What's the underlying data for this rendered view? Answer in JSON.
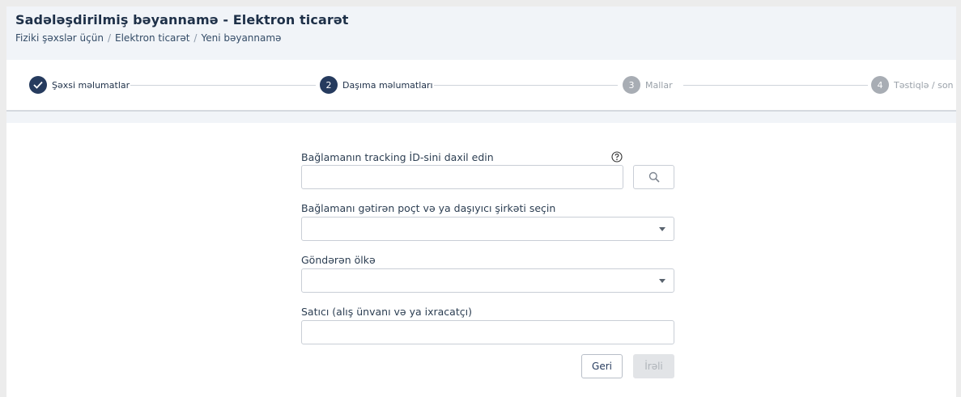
{
  "header": {
    "title": "Sadələşdirilmiş bəyannamə - Elektron ticarət",
    "breadcrumb": [
      "Fiziki şəxslər üçün",
      "Elektron ticarət",
      "Yeni bəyannamə"
    ]
  },
  "steps": [
    {
      "number": "✓",
      "label": "Şəxsi məlumatlar",
      "state": "done"
    },
    {
      "number": "2",
      "label": "Daşıma məlumatları",
      "state": "active"
    },
    {
      "number": "3",
      "label": "Mallar",
      "state": "todo"
    },
    {
      "number": "4",
      "label": "Təstiqlə / son",
      "state": "todo"
    }
  ],
  "form": {
    "tracking": {
      "label": "Bağlamanın tracking İD-sini daxil edin",
      "value": "",
      "help_icon": "question-circle-icon",
      "search_icon": "search-icon"
    },
    "carrier": {
      "label": "Bağlamanı gətirən poçt və ya daşıyıcı şirkəti seçin",
      "value": ""
    },
    "country": {
      "label": "Göndərən ölkə",
      "value": ""
    },
    "seller": {
      "label": "Satıcı (alış ünvanı və ya ixracatçı)",
      "value": ""
    }
  },
  "actions": {
    "back_label": "Geri",
    "next_label": "İrəli"
  },
  "colors": {
    "primary": "#263b5e",
    "inactive": "#a8adb4",
    "header_bg": "#f1f4f8"
  }
}
